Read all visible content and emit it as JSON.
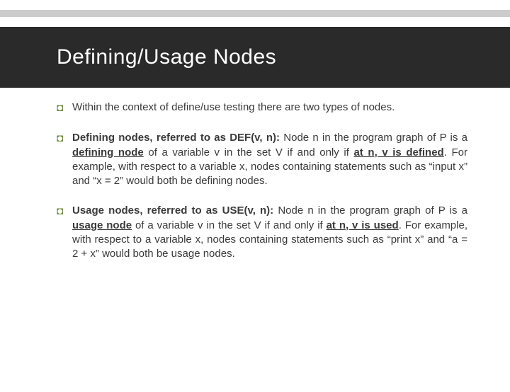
{
  "title": "Defining/Usage Nodes",
  "bullets": {
    "b1": "Within the context of define/use testing there are two types of nodes.",
    "b2_lead": "Defining nodes, referred to as DEF(v, n):",
    "b2_a": " Node n in the program graph of P is a ",
    "b2_defnode": "defining node",
    "b2_b": " of a variable v in the set V if and only if ",
    "b2_atn": "at n, v is defined",
    "b2_c": ". For example, with respect to a variable x, nodes containing statements such as “input x” and “x = 2” would both be defining nodes.",
    "b3_lead": "Usage nodes, referred to as USE(v, n):",
    "b3_a": " Node n in the program graph of P is a ",
    "b3_usenode": "usage node",
    "b3_b": " of a variable v in the set V if and only if ",
    "b3_atn": "at n, v is used",
    "b3_c": ". For example, with respect to a variable x, nodes containing statements such as “print x” and “a = 2 + x” would both be usage nodes."
  }
}
